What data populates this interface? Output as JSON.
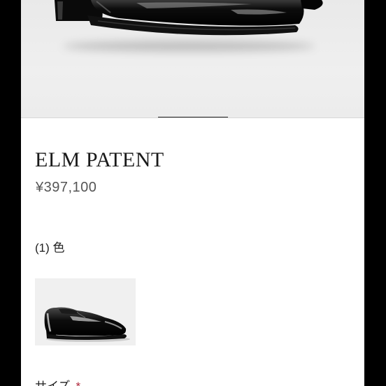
{
  "product": {
    "name": "ELM PATENT",
    "price": "¥397,100"
  },
  "options": {
    "color_label": "(1) 色",
    "size_label": "サイズ",
    "required_marker": "*"
  },
  "colors": {
    "page_background": "#ffffff",
    "frame": "#000000",
    "required": "#b0283c",
    "indicator": "#222222"
  }
}
